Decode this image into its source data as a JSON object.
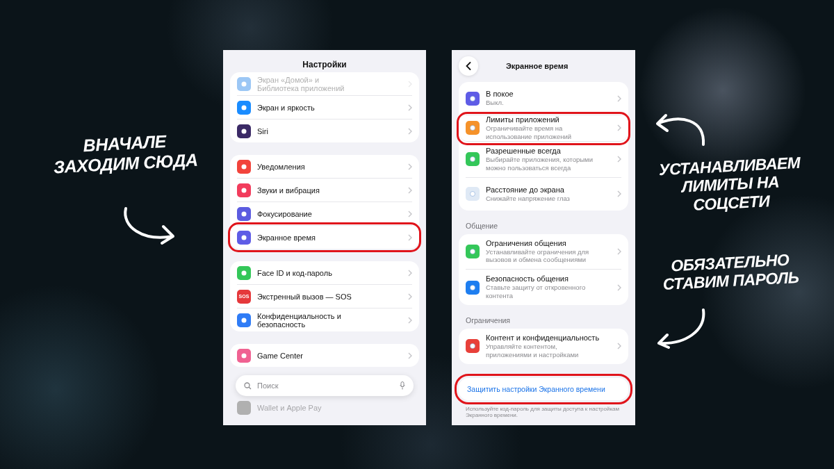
{
  "annotations": [
    {
      "text": "ВНАЧАЛЕ ЗАХОДИМ СЮДА"
    },
    {
      "text": "УСТАНАВЛИВАЕМ ЛИМИТЫ НА СОЦСЕТИ"
    },
    {
      "text": "ОБЯЗАТЕЛЬНО СТАВИМ ПАРОЛЬ"
    }
  ],
  "left": {
    "title": "Настройки",
    "groups": [
      {
        "items": [
          {
            "label": "Экран «Домой» и Библиотека приложений",
            "color": "#9cc7f5",
            "dimmed": true,
            "highlighted": false
          },
          {
            "label": "Экран и яркость",
            "color": "#1a8cff",
            "dimmed": false,
            "highlighted": false
          },
          {
            "label": "Siri",
            "color": "#3b2a66",
            "dimmed": false,
            "highlighted": false
          }
        ]
      },
      {
        "items": [
          {
            "label": "Уведомления",
            "color": "#f2443c",
            "dimmed": false,
            "highlighted": false
          },
          {
            "label": "Звуки и вибрация",
            "color": "#f23c5c",
            "dimmed": false,
            "highlighted": false
          },
          {
            "label": "Фокусирование",
            "color": "#5c5ce0",
            "dimmed": false,
            "highlighted": false
          },
          {
            "label": "Экранное время",
            "color": "#5e5ce6",
            "dimmed": false,
            "highlighted": true
          }
        ]
      },
      {
        "items": [
          {
            "label": "Face ID и код-пароль",
            "color": "#34c759",
            "dimmed": false,
            "highlighted": false
          },
          {
            "label": "Экстренный вызов — SOS",
            "color": "#e5383b",
            "icon_text": "SOS",
            "dimmed": false,
            "highlighted": false
          },
          {
            "label": "Конфиденциальность и безопасность",
            "color": "#2f7cf6",
            "dimmed": false,
            "highlighted": false
          }
        ]
      },
      {
        "items": [
          {
            "label": "Game Center",
            "color": "#f06292",
            "dimmed": false,
            "highlighted": false
          }
        ]
      }
    ],
    "search": {
      "placeholder": "Поиск"
    },
    "bottom_item": {
      "label": "Wallet и Apple Pay",
      "color": "#b0b0b0",
      "dimmed": true
    }
  },
  "right": {
    "title": "Экранное время",
    "sections": [
      {
        "items": [
          {
            "label": "В покое",
            "sublabel": "Выкл.",
            "color": "#5e5ce6",
            "highlighted": false
          },
          {
            "label": "Лимиты приложений",
            "sublabel": "Ограничивайте время на использование приложений",
            "color": "#f5922a",
            "highlighted": true
          },
          {
            "label": "Разрешенные всегда",
            "sublabel": "Выбирайте приложения, которыми можно пользоваться всегда",
            "color": "#34c759",
            "highlighted": false
          },
          {
            "label": "Расстояние до экрана",
            "sublabel": "Снижайте напряжение глаз",
            "color": "#dfe9f5",
            "highlighted": false
          }
        ]
      },
      {
        "header": "Общение",
        "items": [
          {
            "label": "Ограничения общения",
            "sublabel": "Устанавливайте ограничения для вызовов и обмена сообщениями",
            "color": "#34c759",
            "highlighted": false
          },
          {
            "label": "Безопасность общения",
            "sublabel": "Ставьте защиту от откровенного контента",
            "color": "#1e7ef0",
            "highlighted": false
          }
        ]
      },
      {
        "header": "Ограничения",
        "items": [
          {
            "label": "Контент и конфиденциальность",
            "sublabel": "Управляйте контентом, приложениями и настройками",
            "color": "#e8403a",
            "highlighted": false
          }
        ]
      }
    ],
    "action": {
      "label": "Защитить настройки Экранного времени",
      "highlighted": true
    },
    "footer": "Используйте код-пароль для защиты доступа к настройкам Экранного времени."
  }
}
